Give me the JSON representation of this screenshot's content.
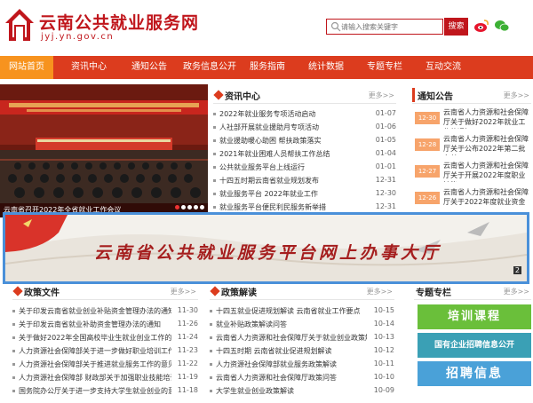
{
  "header": {
    "site_title": "云南公共就业服务网",
    "site_url": "jyj.yn.gov.cn",
    "search_placeholder": "请输入搜索关键字",
    "search_button": "搜索"
  },
  "nav": {
    "items": [
      {
        "label": "网站首页",
        "active": true
      },
      {
        "label": "资讯中心",
        "active": false
      },
      {
        "label": "通知公告",
        "active": false
      },
      {
        "label": "政务信息公开",
        "active": false
      },
      {
        "label": "服务指南",
        "active": false
      },
      {
        "label": "统计数据",
        "active": false
      },
      {
        "label": "专题专栏",
        "active": false
      },
      {
        "label": "互动交流",
        "active": false
      }
    ]
  },
  "slide": {
    "caption": "云南省召开2022年全省就业工作会议",
    "dots": 5,
    "active_dot": 0
  },
  "news": {
    "title": "资讯中心",
    "more": "更多>>",
    "items": [
      {
        "text": "2022年就业服务专项活动启动",
        "date": "01-07"
      },
      {
        "text": "人社部开展就业援助月专项活动",
        "date": "01-06"
      },
      {
        "text": "就业援助暖心助困 帮扶政策落实",
        "date": "01-05"
      },
      {
        "text": "2021年就业困难人员帮扶工作总结",
        "date": "01-04"
      },
      {
        "text": "公共就业服务平台上线运行",
        "date": "01-01"
      },
      {
        "text": "十四五时期云南省就业规划发布",
        "date": "12-31"
      },
      {
        "text": "就业服务平台 2022年就业工作",
        "date": "12-30"
      },
      {
        "text": "就业服务平台便民利民服务新举措",
        "date": "12-31"
      }
    ]
  },
  "notices": {
    "title": "通知公告",
    "more": "更多>>",
    "items": [
      {
        "date": "12-30",
        "text": "云南省人力资源和社会保障厅关于做好2022年就业工作的通知"
      },
      {
        "date": "12-28",
        "text": "云南省人力资源和社会保障厅关于公布2022年第二批名单"
      },
      {
        "date": "12-27",
        "text": "云南省人力资源和社会保障厅关于开展2022年度职业技能"
      },
      {
        "date": "12-26",
        "text": "云南省人力资源和社会保障厅关于2022年度就业资金"
      }
    ]
  },
  "banner": {
    "text": "云南省公共就业服务平台网上办事大厅",
    "page_num": "2"
  },
  "policy_docs": {
    "title": "政策文件",
    "more": "更多>>",
    "items": [
      {
        "text": "关于印发云南省就业创业补贴资金管理办法的通知",
        "date": "11-30"
      },
      {
        "text": "关于印发云南省就业补助资金管理办法的通知",
        "date": "11-26"
      },
      {
        "text": "关于做好2022年全国高校毕业生就业创业工作的通知",
        "date": "11-24"
      },
      {
        "text": "人力资源社会保障部关于进一步做好职业培训工作",
        "date": "11-23"
      },
      {
        "text": "人力资源社会保障部关于推进就业服务工作的意见",
        "date": "11-22"
      },
      {
        "text": "人力资源社会保障部 财政部关于加强职业技能培训",
        "date": "11-19"
      },
      {
        "text": "国务院办公厅关于进一步支持大学生就业创业的意见",
        "date": "11-18"
      }
    ]
  },
  "policy_reading": {
    "title": "政策解读",
    "more": "更多>>",
    "items": [
      {
        "text": "十四五就业促进规划解读 云南省就业工作要点",
        "date": "10-15"
      },
      {
        "text": "就业补贴政策解读问答",
        "date": "10-14"
      },
      {
        "text": "云南省人力资源和社会保障厅关于就业创业政策解读",
        "date": "10-13"
      },
      {
        "text": "十四五时期 云南省就业促进规划解读",
        "date": "10-12"
      },
      {
        "text": "人力资源社会保障部就业服务政策解读",
        "date": "10-11"
      },
      {
        "text": "云南省人力资源和社会保障厅政策问答",
        "date": "10-10"
      },
      {
        "text": "大学生就业创业政策解读",
        "date": "10-09"
      }
    ]
  },
  "topics": {
    "title": "专题专栏",
    "more": "更多>>",
    "items": [
      {
        "text": "培训课程",
        "color": "#6abf3a"
      },
      {
        "text": "国有企业招聘信息公开",
        "color": "#3aa0b5"
      },
      {
        "text": "招聘信息",
        "color": "#4aa1d8"
      }
    ]
  },
  "colors": {
    "brand_red": "#c0161c",
    "nav_red": "#dc3c1e",
    "nav_active": "#f7931e",
    "banner_border": "#4a90d9"
  }
}
